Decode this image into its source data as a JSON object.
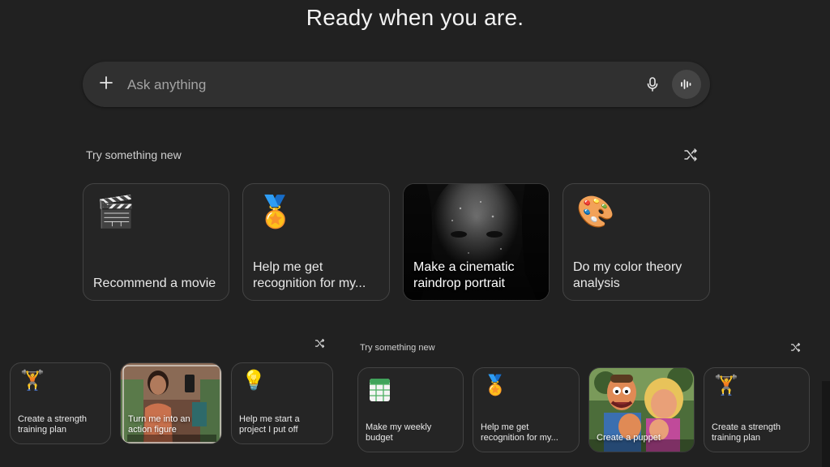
{
  "header": {
    "title": "Ready when you are."
  },
  "search": {
    "placeholder": "Ask anything",
    "icons": {
      "add": "plus-icon",
      "mic": "microphone-icon",
      "voice": "voice-mode-icon"
    }
  },
  "suggestions_main": {
    "heading": "Try something new",
    "shuffle_icon": "shuffle-icon",
    "cards": [
      {
        "label": "Recommend a movie",
        "icon": "clapperboard-icon",
        "emoji": "🎬"
      },
      {
        "label": "Help me get recognition for my...",
        "icon": "award-ribbon-icon",
        "emoji": "🏅"
      },
      {
        "label": "Make a cinematic raindrop portrait",
        "icon": "portrait-photo",
        "emoji": ""
      },
      {
        "label": "Do my color theory analysis",
        "icon": "palette-icon",
        "emoji": "🎨"
      }
    ]
  },
  "suggestions_left": {
    "shuffle_icon": "shuffle-icon",
    "cards": [
      {
        "label": "Create a strength training plan",
        "icon": "dumbbell-icon",
        "emoji": "🏋️"
      },
      {
        "label": "Turn me into an action figure",
        "icon": "action-figure-photo",
        "emoji": ""
      },
      {
        "label": "Help me start a project I put off",
        "icon": "lightbulb-icon",
        "emoji": "💡"
      }
    ]
  },
  "suggestions_right": {
    "heading": "Try something new",
    "shuffle_icon": "shuffle-icon",
    "cards": [
      {
        "label": "Make my weekly budget",
        "icon": "spreadsheet-icon",
        "emoji": ""
      },
      {
        "label": "Help me get recognition for my...",
        "icon": "award-ribbon-icon",
        "emoji": "🏅"
      },
      {
        "label": "Create a puppet",
        "icon": "puppet-photo",
        "emoji": ""
      },
      {
        "label": "Create a strength training plan",
        "icon": "dumbbell-icon",
        "emoji": "🏋️"
      }
    ]
  },
  "colors": {
    "background": "#212121",
    "card": "#252525",
    "card_border": "#434343",
    "input": "#303030"
  }
}
